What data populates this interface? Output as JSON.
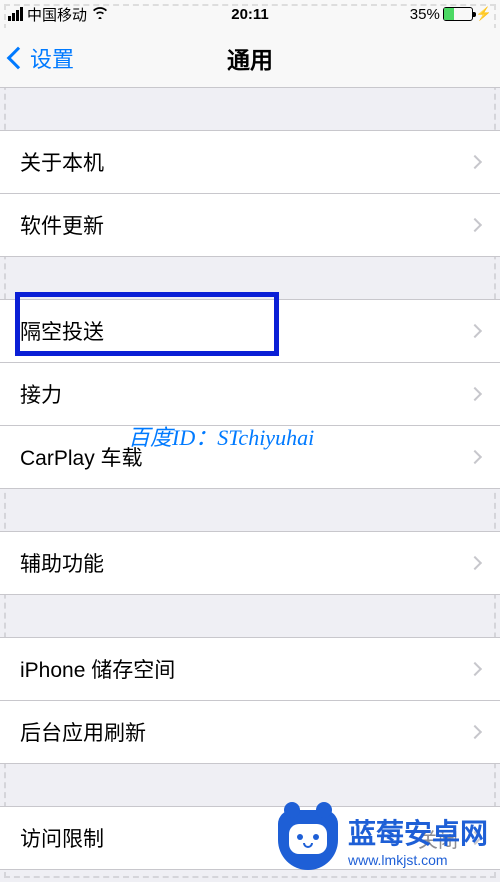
{
  "status_bar": {
    "carrier": "中国移动",
    "time": "20:11",
    "battery_pct": "35%"
  },
  "nav": {
    "back_label": "设置",
    "title": "通用"
  },
  "sections": {
    "group1": [
      {
        "label": "关于本机"
      },
      {
        "label": "软件更新"
      }
    ],
    "group2": [
      {
        "label": "隔空投送"
      },
      {
        "label": "接力"
      },
      {
        "label": "CarPlay 车载"
      }
    ],
    "group3": [
      {
        "label": "辅助功能"
      }
    ],
    "group4": [
      {
        "label": "iPhone 储存空间"
      },
      {
        "label": "后台应用刷新"
      }
    ],
    "group5": [
      {
        "label": "访问限制",
        "value": "关闭"
      }
    ]
  },
  "watermark": {
    "text": "百度ID：STchiyuhai"
  },
  "brand": {
    "name": "蓝莓安卓网",
    "url": "www.lmkjst.com"
  }
}
